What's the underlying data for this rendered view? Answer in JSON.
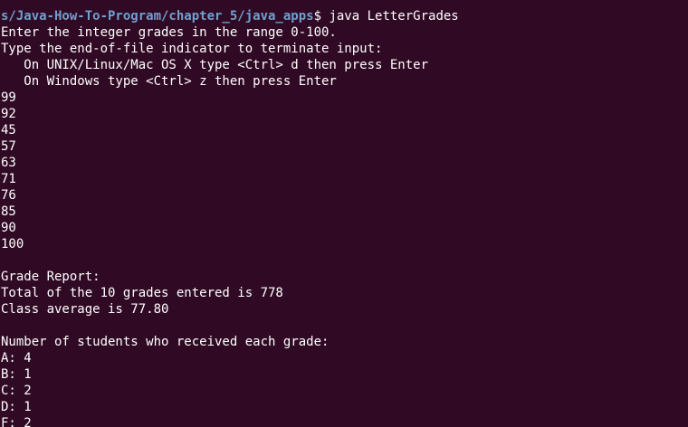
{
  "terminal": {
    "top_partial": "",
    "prompt_path": "s/Java-How-To-Program/chapter_5/java_apps",
    "prompt_symbol": "$",
    "command": " java LetterGrades",
    "output": [
      "Enter the integer grades in the range 0-100.",
      "Type the end-of-file indicator to terminate input:",
      "   On UNIX/Linux/Mac OS X type <Ctrl> d then press Enter",
      "   On Windows type <Ctrl> z then press Enter",
      "99",
      "92",
      "45",
      "57",
      "63",
      "71",
      "76",
      "85",
      "90",
      "100",
      "",
      "Grade Report:",
      "Total of the 10 grades entered is 778",
      "Class average is 77.80",
      "",
      "Number of students who received each grade:",
      "A: 4",
      "B: 1",
      "C: 2",
      "D: 1",
      "F: 2"
    ]
  },
  "colors": {
    "background": "#300a24",
    "prompt": "#729fcf",
    "text": "#ffffff"
  }
}
